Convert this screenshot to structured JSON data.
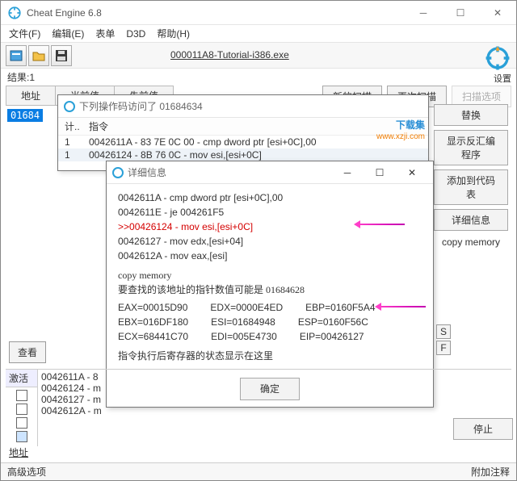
{
  "window": {
    "title": "Cheat Engine 6.8"
  },
  "menu": {
    "file": "文件(F)",
    "edit": "编辑(E)",
    "table": "表单",
    "d3d": "D3D",
    "help": "帮助(H)"
  },
  "toolbar": {
    "target": "000011A8-Tutorial-i386.exe"
  },
  "results": {
    "label": "结果:",
    "count": "1"
  },
  "columns": {
    "addr": "地址",
    "curval": "当前值",
    "prevval": "先前值"
  },
  "btns": {
    "newscan": "新的扫描",
    "nextscan": "再次扫描",
    "scanopt": "扫描选项",
    "settings": "设置"
  },
  "selected_addr": "01684",
  "opwin": {
    "title": "下列操作码访问了 01684634",
    "col1": "计..",
    "col2": "指令",
    "rows": [
      {
        "n": "1",
        "t": "0042611A - 83 7E 0C 00 - cmp dword ptr [esi+0C],00"
      },
      {
        "n": "1",
        "t": "00426124 - 8B 76 0C - mov esi,[esi+0C]"
      }
    ],
    "watermark1": "下载集",
    "watermark2": "www.xzji.com"
  },
  "right": {
    "replace": "替换",
    "disasm": "显示反汇编程序",
    "addcode": "添加到代码表",
    "detail": "详细信息",
    "copy": "copy memory"
  },
  "detail": {
    "title": "详细信息",
    "l1": "0042611A - cmp dword ptr [esi+0C],00",
    "l2": "0042611E - je 004261F5",
    "l3": ">>00426124 - mov esi,[esi+0C]",
    "l4": "00426127 - mov edx,[esi+04]",
    "l5": "0042612A - mov eax,[esi]",
    "copy": "copy memory",
    "hint": "要查找的该地址的指针数值可能是 01684628",
    "reg": {
      "eax": "EAX=00015D90",
      "edx": "EDX=0000E4ED",
      "ebp": "EBP=0160F5A4",
      "ebx": "EBX=016DF180",
      "esi": "ESI=01684948",
      "esp": "ESP=0160F56C",
      "ecx": "ECX=68441C70",
      "edi": "EDI=005E4730",
      "eip": "EIP=00426127"
    },
    "foot": "指令执行后寄存器的状态显示在这里",
    "ok": "确定"
  },
  "bottom": {
    "search": "查看",
    "activate": "激活",
    "rows": [
      "0042611A - 8",
      "00426124 - m",
      "00426127 - m",
      "0042612A - m"
    ],
    "stop": "停止"
  },
  "addr_label": "地址",
  "status": {
    "adv": "高级选项",
    "attach": "附加注释"
  }
}
